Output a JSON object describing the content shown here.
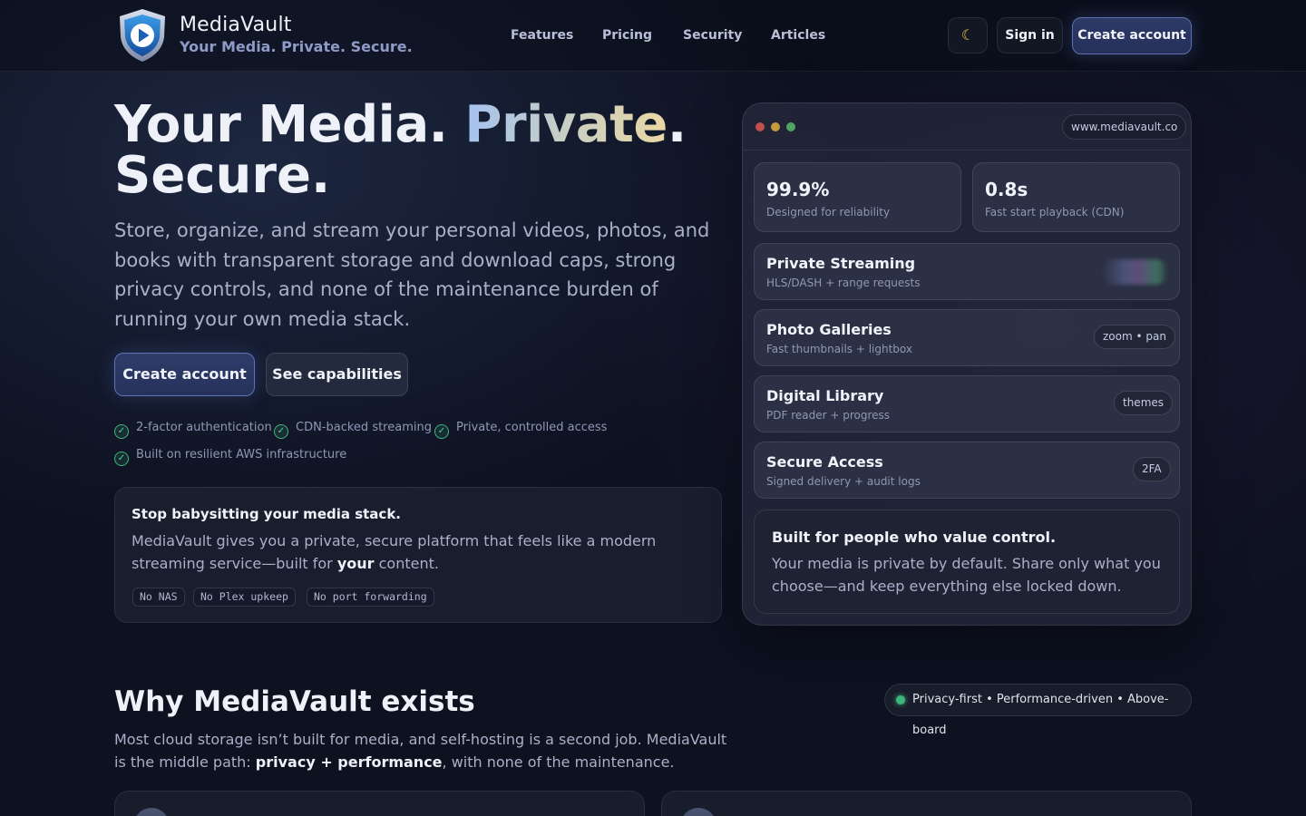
{
  "header": {
    "brand": "MediaVault",
    "tagline": "Your Media. Private. Secure.",
    "nav": [
      "Features",
      "Pricing",
      "Security",
      "Articles"
    ],
    "theme_icon": "moon-icon",
    "sign_in": "Sign in",
    "create_account": "Create account"
  },
  "hero": {
    "title_a": "Your Media. ",
    "title_b": "Private",
    "title_c": ".",
    "title_d": "Secure.",
    "description": "Store, organize, and stream your personal videos, photos, and books with transparent storage and download caps, strong privacy controls, and none of the maintenance burden of running your own media stack.",
    "cta_primary": "Create account",
    "cta_secondary": "See capabilities",
    "features": [
      "2-factor authentication",
      "CDN-backed streaming",
      "Private, controlled access",
      "Built on resilient AWS infrastructure"
    ]
  },
  "stop_card": {
    "title": "Stop babysitting your media stack.",
    "text_a": "MediaVault gives you a private, secure platform that feels like a modern streaming service—built for ",
    "text_bold": "your",
    "text_b": " content.",
    "tags": [
      "No NAS",
      "No Plex upkeep",
      "No port forwarding"
    ]
  },
  "panel": {
    "url": "www.mediavault.co",
    "stats": [
      {
        "value": "99.9%",
        "label": "Designed for reliability"
      },
      {
        "value": "0.8s",
        "label": "Fast start playback (CDN)"
      }
    ],
    "rows": [
      {
        "title": "Private Streaming",
        "sub": "HLS/DASH + range requests",
        "chip": ""
      },
      {
        "title": "Photo Galleries",
        "sub": "Fast thumbnails + lightbox",
        "chip": "zoom • pan"
      },
      {
        "title": "Digital Library",
        "sub": "PDF reader + progress",
        "chip": "themes"
      },
      {
        "title": "Secure Access",
        "sub": "Signed delivery + audit logs",
        "chip": "2FA"
      }
    ],
    "control_title": "Built for people who value control.",
    "control_text": "Your media is private by default. Share only what you choose—and keep everything else locked down."
  },
  "why": {
    "title": "Why MediaVault exists",
    "text_a": "Most cloud storage isn’t built for media, and self-hosting is a second job. MediaVault is the middle path: ",
    "text_bold": "privacy + performance",
    "text_b": ", with none of the maintenance.",
    "pill": "Privacy-first • Performance-driven • Above-board"
  },
  "colors": {
    "accent": "#5f72b4",
    "success": "#3fb57a",
    "background": "#0d1120"
  }
}
